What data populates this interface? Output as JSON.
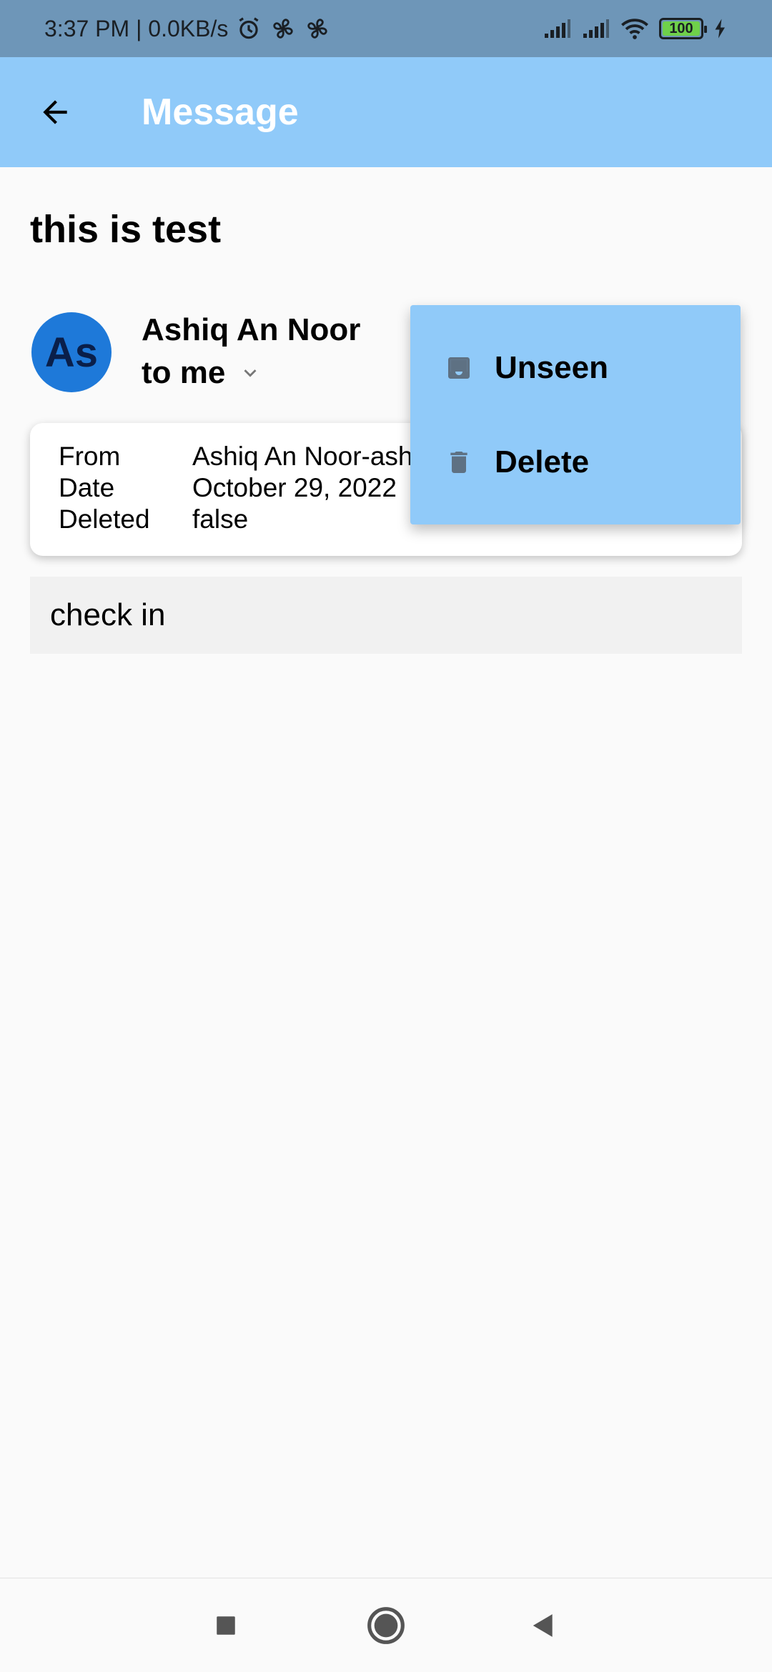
{
  "status_bar": {
    "time_speed": "3:37 PM | 0.0KB/s",
    "battery_level": "100",
    "icons": [
      "alarm-icon",
      "fan-icon",
      "fan-icon",
      "signal-icon",
      "signal-icon",
      "wifi-icon",
      "battery-icon",
      "charging-icon"
    ]
  },
  "app_bar": {
    "title": "Message",
    "back_icon": "arrow-back-icon",
    "background": "#90caf9"
  },
  "message": {
    "subject": "this is test",
    "avatar_text": "As",
    "sender_name": "Ashiq An Noor",
    "to_label": "to me",
    "details": {
      "from_label": "From",
      "from_value": "Ashiq An Noor-ash",
      "date_label": "Date",
      "date_value": "October 29, 2022",
      "deleted_label": "Deleted",
      "deleted_value": "false"
    },
    "body": "check in"
  },
  "popup_menu": {
    "items": [
      {
        "label": "Unseen",
        "icon": "inbox-icon"
      },
      {
        "label": "Delete",
        "icon": "trash-icon"
      }
    ]
  },
  "nav_bar": {
    "buttons": [
      "recents-icon",
      "home-icon",
      "back-icon"
    ]
  }
}
